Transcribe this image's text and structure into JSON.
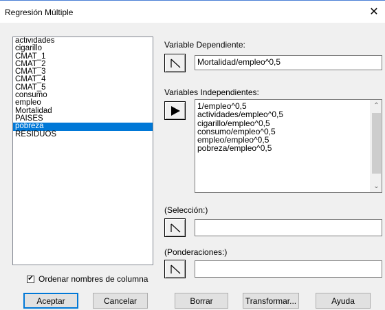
{
  "window": {
    "title": "Regresión Múltiple",
    "close_glyph": "✕"
  },
  "columns_list": {
    "items": [
      {
        "label": "actividades",
        "selected": false
      },
      {
        "label": "cigarillo",
        "selected": false
      },
      {
        "label": "CMAT_1",
        "selected": false
      },
      {
        "label": "CMAT_2",
        "selected": false
      },
      {
        "label": "CMAT_3",
        "selected": false
      },
      {
        "label": "CMAT_4",
        "selected": false
      },
      {
        "label": "CMAT_5",
        "selected": false
      },
      {
        "label": "consumo",
        "selected": false
      },
      {
        "label": "empleo",
        "selected": false
      },
      {
        "label": "Mortalidad",
        "selected": false
      },
      {
        "label": "PAISES",
        "selected": false
      },
      {
        "label": "pobreza",
        "selected": true
      },
      {
        "label": "RESIDUOS",
        "selected": false
      }
    ],
    "selection_color": "#0078d7"
  },
  "sort_option": {
    "label": "Ordenar nombres de columna",
    "checked": true,
    "check_glyph": "✔"
  },
  "dependent": {
    "label": "Variable Dependiente:",
    "value": "Mortalidad/empleo^0,5",
    "button_icon": "outline-arrow-icon"
  },
  "independent": {
    "label": "Variables Independientes:",
    "button_icon": "filled-arrow-icon",
    "lines": [
      "1/empleo^0,5",
      "actividades/empleo^0,5",
      "cigarillo/empleo^0,5",
      "consumo/empleo^0,5",
      "empleo/empleo^0,5",
      "pobreza/empleo^0,5"
    ],
    "scroll_up_glyph": "⌃",
    "scroll_down_glyph": "⌄"
  },
  "selection": {
    "label": "(Selección:)",
    "value": "",
    "button_icon": "outline-arrow-icon"
  },
  "weights": {
    "label": "(Ponderaciones:)",
    "value": "",
    "button_icon": "outline-arrow-icon"
  },
  "buttons": {
    "accept": "Aceptar",
    "cancel": "Cancelar",
    "clear": "Borrar",
    "transform": "Transformar...",
    "help": "Ayuda"
  }
}
